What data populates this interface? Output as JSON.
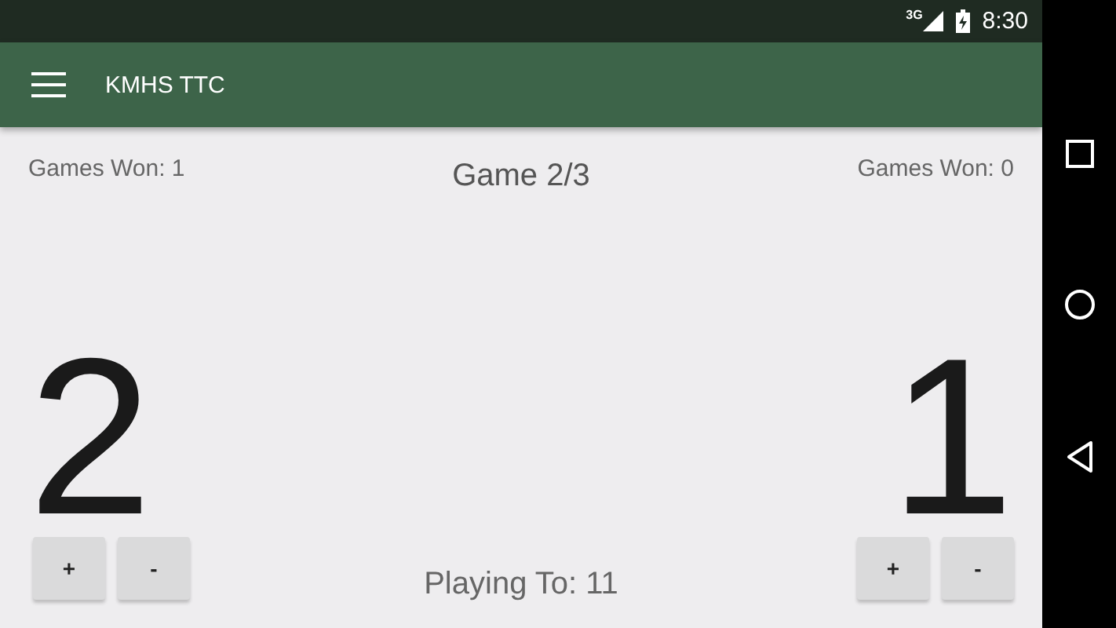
{
  "status_bar": {
    "network": "3G",
    "time": "8:30"
  },
  "app_bar": {
    "title": "KMHS TTC"
  },
  "header": {
    "left_games_won": "Games Won: 1",
    "game": "Game 2/3",
    "right_games_won": "Games Won: 0"
  },
  "players": [
    {
      "score": "2",
      "buttons": [
        "+",
        "-"
      ]
    },
    {
      "score": "1",
      "buttons": [
        "+",
        "-"
      ]
    }
  ],
  "playing_to": "Playing To: 11"
}
